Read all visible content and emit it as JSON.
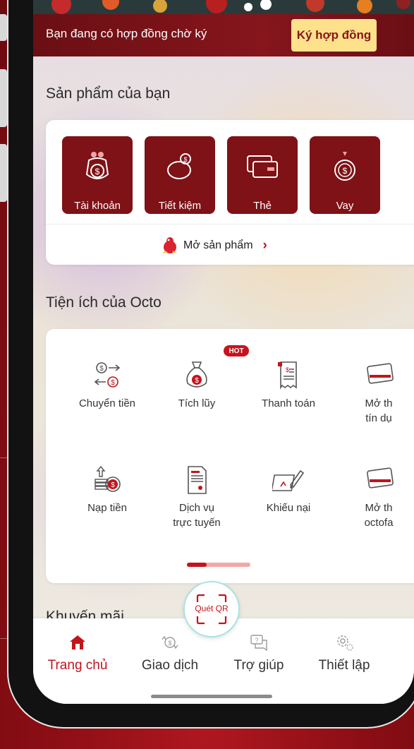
{
  "banner": {
    "message": "Bạn đang có hợp đồng chờ ký",
    "sign_label": "Ký hợp đồng"
  },
  "products": {
    "title": "Sản phẩm của bạn",
    "items": [
      {
        "label": "Tài khoản",
        "icon": "money-bag-icon"
      },
      {
        "label": "Tiết kiệm",
        "icon": "piggy-bank-icon"
      },
      {
        "label": "Thẻ",
        "icon": "cards-icon"
      },
      {
        "label": "Vay",
        "icon": "loan-bag-icon"
      }
    ],
    "open_label": "Mở sản phẩm"
  },
  "utilities": {
    "title": "Tiện ích của Octo",
    "hot_badge": "HOT",
    "row1": [
      {
        "label": "Chuyển tiền",
        "icon": "transfer-icon"
      },
      {
        "label": "Tích lũy",
        "icon": "savings-bag-icon"
      },
      {
        "label": "Thanh toán",
        "icon": "bill-icon"
      },
      {
        "label": "Mở th\ntín dụ",
        "icon": "credit-card-icon"
      }
    ],
    "row2": [
      {
        "label": "Nạp tiền",
        "icon": "deposit-icon"
      },
      {
        "label": "Dịch vụ\ntrực tuyến",
        "icon": "document-icon"
      },
      {
        "label": "Khiếu nại",
        "icon": "complaint-icon"
      },
      {
        "label": "Mở th\noctofa",
        "icon": "fast-card-icon"
      }
    ]
  },
  "promotions": {
    "title": "Khuyến mãi"
  },
  "qr": {
    "label": "Quét QR"
  },
  "tabs": [
    {
      "label": "Trang chủ",
      "icon": "home-icon",
      "active": true
    },
    {
      "label": "Giao dịch",
      "icon": "transaction-icon",
      "active": false
    },
    {
      "label": "Trợ giúp",
      "icon": "help-icon",
      "active": false
    },
    {
      "label": "Thiết lập",
      "icon": "settings-icon",
      "active": false
    }
  ],
  "colors": {
    "brand_red": "#c3141d",
    "tile_red": "#7e1216",
    "sign_yellow": "#fde28b",
    "outer_bg": "#8d1016"
  }
}
